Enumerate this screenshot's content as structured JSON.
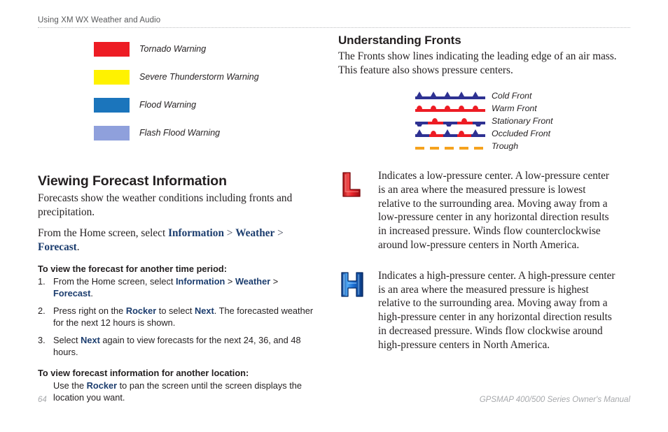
{
  "header": {
    "title": "Using XM WX Weather and Audio"
  },
  "warnings_legend": {
    "items": [
      {
        "label": "Tornado Warning",
        "color": "#ED1C24"
      },
      {
        "label": "Severe Thunderstorm Warning",
        "color": "#FFF200"
      },
      {
        "label": "Flood Warning",
        "color": "#1B75BC"
      },
      {
        "label": "Flash Flood Warning",
        "color": "#8FA0DC"
      }
    ]
  },
  "left_column": {
    "heading": "Viewing Forecast Information",
    "intro_paragraph": "Forecasts show the weather conditions including fronts and precipitation.",
    "navigation_sentence": {
      "prefix": "From the Home screen, select ",
      "term1": "Information",
      "sep1": " > ",
      "term2": "Weather",
      "sep2": " > ",
      "term3": "Forecast",
      "suffix": "."
    },
    "procedure_time_period": {
      "title": "To view the forecast for another time period:",
      "steps": [
        {
          "number": "1.",
          "prefix": "From the Home screen, select ",
          "term1": "Information",
          "sep1": " > ",
          "term2": "Weather",
          "sep2": " > ",
          "term3": "Forecast",
          "suffix": "."
        },
        {
          "number": "2.",
          "prefix": "Press right on the ",
          "term1": "Rocker",
          "mid": " to select ",
          "term2": "Next",
          "suffix": ". The forecasted weather for the next 12 hours is shown."
        },
        {
          "number": "3.",
          "prefix": "Select ",
          "term1": "Next",
          "suffix": " again to view forecasts for the next 24, 36, and 48 hours."
        }
      ]
    },
    "procedure_location": {
      "title": "To view forecast information for another location:",
      "body_prefix": "Use the ",
      "body_term": "Rocker",
      "body_suffix": " to pan the screen until the screen displays the location you want."
    }
  },
  "right_column": {
    "heading": "Understanding Fronts",
    "intro_paragraph": "The Fronts show lines indicating the leading edge of an air mass. This feature also shows pressure centers.",
    "fronts_legend": {
      "items": [
        {
          "label": "Cold Front",
          "symbol": "cold-front"
        },
        {
          "label": "Warm Front",
          "symbol": "warm-front"
        },
        {
          "label": "Stationary Front",
          "symbol": "stationary-front"
        },
        {
          "label": "Occluded Front",
          "symbol": "occluded-front"
        },
        {
          "label": "Trough",
          "symbol": "trough"
        }
      ],
      "colors": {
        "cold_blue": "#2E3192",
        "warm_red": "#ED1C24",
        "trough_orange": "#F5A21E"
      }
    },
    "pressure_centers": [
      {
        "icon": "low-pressure-L",
        "icon_color": "#E8232A",
        "text": "Indicates a low-pressure center. A low-pressure center is an area where the measured pressure is lowest relative to the surrounding area. Moving away from a low-pressure center in any horizontal direction results in increased pressure. Winds flow counterclockwise around low-pressure centers in North America."
      },
      {
        "icon": "high-pressure-H",
        "icon_color": "#1B6FD4",
        "text": "Indicates a high-pressure center. A high-pressure center is an area where the measured pressure is highest relative to the surrounding area. Moving away from a high-pressure center in any horizontal direction results in decreased pressure. Winds flow clockwise around high-pressure centers in North America."
      }
    ]
  },
  "footer": {
    "page_number": "64",
    "manual_title": "GPSMAP 400/500 Series Owner's Manual"
  }
}
